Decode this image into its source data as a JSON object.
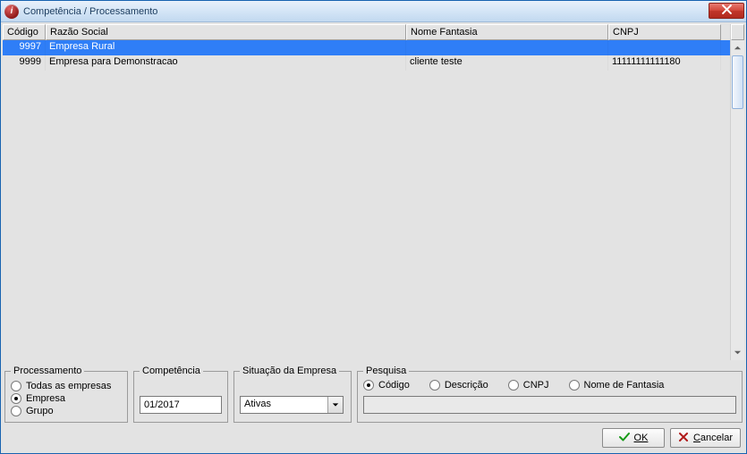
{
  "window": {
    "title": "Competência / Processamento"
  },
  "grid": {
    "headers": {
      "codigo": "Código",
      "razao": "Razão Social",
      "nome": "Nome Fantasia",
      "cnpj": "CNPJ"
    },
    "rows": [
      {
        "codigo": "9997",
        "razao": "Empresa Rural",
        "nome": "",
        "cnpj": "",
        "selected": true
      },
      {
        "codigo": "9999",
        "razao": "Empresa para Demonstracao",
        "nome": "cliente teste",
        "cnpj": "11111111111180",
        "selected": false
      }
    ]
  },
  "group_process": {
    "legend": "Processamento",
    "options": {
      "todas": "Todas as empresas",
      "empresa": "Empresa",
      "grupo": "Grupo"
    },
    "selected": "empresa"
  },
  "group_comp": {
    "legend": "Competência",
    "value": "01/2017"
  },
  "group_sit": {
    "legend": "Situação da Empresa",
    "value": "Ativas"
  },
  "group_search": {
    "legend": "Pesquisa",
    "options": {
      "codigo": "Código",
      "descricao": "Descrição",
      "cnpj": "CNPJ",
      "nome": "Nome de Fantasia"
    },
    "selected": "codigo",
    "value": ""
  },
  "buttons": {
    "ok": "OK",
    "cancel": "Cancelar"
  }
}
